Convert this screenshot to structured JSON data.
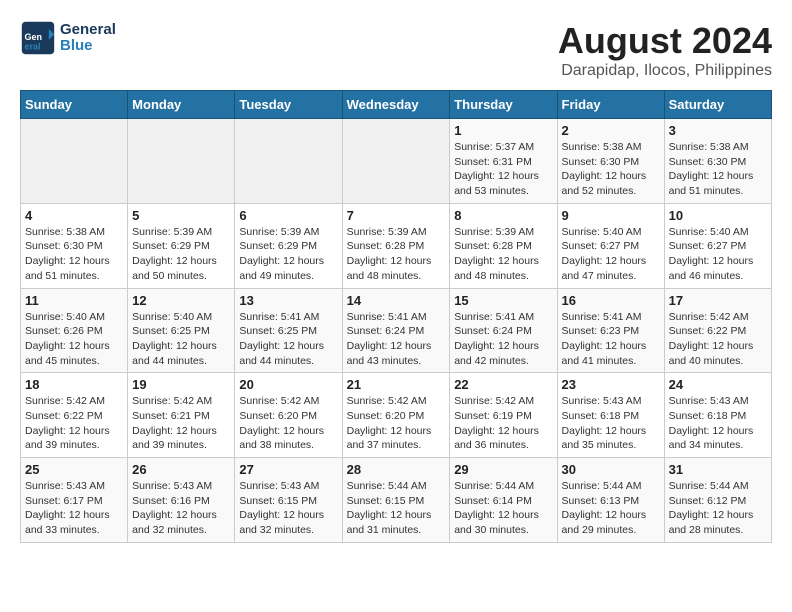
{
  "header": {
    "logo_general": "General",
    "logo_blue": "Blue",
    "title": "August 2024",
    "subtitle": "Darapidap, Ilocos, Philippines"
  },
  "days_of_week": [
    "Sunday",
    "Monday",
    "Tuesday",
    "Wednesday",
    "Thursday",
    "Friday",
    "Saturday"
  ],
  "weeks": [
    [
      {
        "day": "",
        "info": ""
      },
      {
        "day": "",
        "info": ""
      },
      {
        "day": "",
        "info": ""
      },
      {
        "day": "",
        "info": ""
      },
      {
        "day": "1",
        "info": "Sunrise: 5:37 AM\nSunset: 6:31 PM\nDaylight: 12 hours\nand 53 minutes."
      },
      {
        "day": "2",
        "info": "Sunrise: 5:38 AM\nSunset: 6:30 PM\nDaylight: 12 hours\nand 52 minutes."
      },
      {
        "day": "3",
        "info": "Sunrise: 5:38 AM\nSunset: 6:30 PM\nDaylight: 12 hours\nand 51 minutes."
      }
    ],
    [
      {
        "day": "4",
        "info": "Sunrise: 5:38 AM\nSunset: 6:30 PM\nDaylight: 12 hours\nand 51 minutes."
      },
      {
        "day": "5",
        "info": "Sunrise: 5:39 AM\nSunset: 6:29 PM\nDaylight: 12 hours\nand 50 minutes."
      },
      {
        "day": "6",
        "info": "Sunrise: 5:39 AM\nSunset: 6:29 PM\nDaylight: 12 hours\nand 49 minutes."
      },
      {
        "day": "7",
        "info": "Sunrise: 5:39 AM\nSunset: 6:28 PM\nDaylight: 12 hours\nand 48 minutes."
      },
      {
        "day": "8",
        "info": "Sunrise: 5:39 AM\nSunset: 6:28 PM\nDaylight: 12 hours\nand 48 minutes."
      },
      {
        "day": "9",
        "info": "Sunrise: 5:40 AM\nSunset: 6:27 PM\nDaylight: 12 hours\nand 47 minutes."
      },
      {
        "day": "10",
        "info": "Sunrise: 5:40 AM\nSunset: 6:27 PM\nDaylight: 12 hours\nand 46 minutes."
      }
    ],
    [
      {
        "day": "11",
        "info": "Sunrise: 5:40 AM\nSunset: 6:26 PM\nDaylight: 12 hours\nand 45 minutes."
      },
      {
        "day": "12",
        "info": "Sunrise: 5:40 AM\nSunset: 6:25 PM\nDaylight: 12 hours\nand 44 minutes."
      },
      {
        "day": "13",
        "info": "Sunrise: 5:41 AM\nSunset: 6:25 PM\nDaylight: 12 hours\nand 44 minutes."
      },
      {
        "day": "14",
        "info": "Sunrise: 5:41 AM\nSunset: 6:24 PM\nDaylight: 12 hours\nand 43 minutes."
      },
      {
        "day": "15",
        "info": "Sunrise: 5:41 AM\nSunset: 6:24 PM\nDaylight: 12 hours\nand 42 minutes."
      },
      {
        "day": "16",
        "info": "Sunrise: 5:41 AM\nSunset: 6:23 PM\nDaylight: 12 hours\nand 41 minutes."
      },
      {
        "day": "17",
        "info": "Sunrise: 5:42 AM\nSunset: 6:22 PM\nDaylight: 12 hours\nand 40 minutes."
      }
    ],
    [
      {
        "day": "18",
        "info": "Sunrise: 5:42 AM\nSunset: 6:22 PM\nDaylight: 12 hours\nand 39 minutes."
      },
      {
        "day": "19",
        "info": "Sunrise: 5:42 AM\nSunset: 6:21 PM\nDaylight: 12 hours\nand 39 minutes."
      },
      {
        "day": "20",
        "info": "Sunrise: 5:42 AM\nSunset: 6:20 PM\nDaylight: 12 hours\nand 38 minutes."
      },
      {
        "day": "21",
        "info": "Sunrise: 5:42 AM\nSunset: 6:20 PM\nDaylight: 12 hours\nand 37 minutes."
      },
      {
        "day": "22",
        "info": "Sunrise: 5:42 AM\nSunset: 6:19 PM\nDaylight: 12 hours\nand 36 minutes."
      },
      {
        "day": "23",
        "info": "Sunrise: 5:43 AM\nSunset: 6:18 PM\nDaylight: 12 hours\nand 35 minutes."
      },
      {
        "day": "24",
        "info": "Sunrise: 5:43 AM\nSunset: 6:18 PM\nDaylight: 12 hours\nand 34 minutes."
      }
    ],
    [
      {
        "day": "25",
        "info": "Sunrise: 5:43 AM\nSunset: 6:17 PM\nDaylight: 12 hours\nand 33 minutes."
      },
      {
        "day": "26",
        "info": "Sunrise: 5:43 AM\nSunset: 6:16 PM\nDaylight: 12 hours\nand 32 minutes."
      },
      {
        "day": "27",
        "info": "Sunrise: 5:43 AM\nSunset: 6:15 PM\nDaylight: 12 hours\nand 32 minutes."
      },
      {
        "day": "28",
        "info": "Sunrise: 5:44 AM\nSunset: 6:15 PM\nDaylight: 12 hours\nand 31 minutes."
      },
      {
        "day": "29",
        "info": "Sunrise: 5:44 AM\nSunset: 6:14 PM\nDaylight: 12 hours\nand 30 minutes."
      },
      {
        "day": "30",
        "info": "Sunrise: 5:44 AM\nSunset: 6:13 PM\nDaylight: 12 hours\nand 29 minutes."
      },
      {
        "day": "31",
        "info": "Sunrise: 5:44 AM\nSunset: 6:12 PM\nDaylight: 12 hours\nand 28 minutes."
      }
    ]
  ]
}
